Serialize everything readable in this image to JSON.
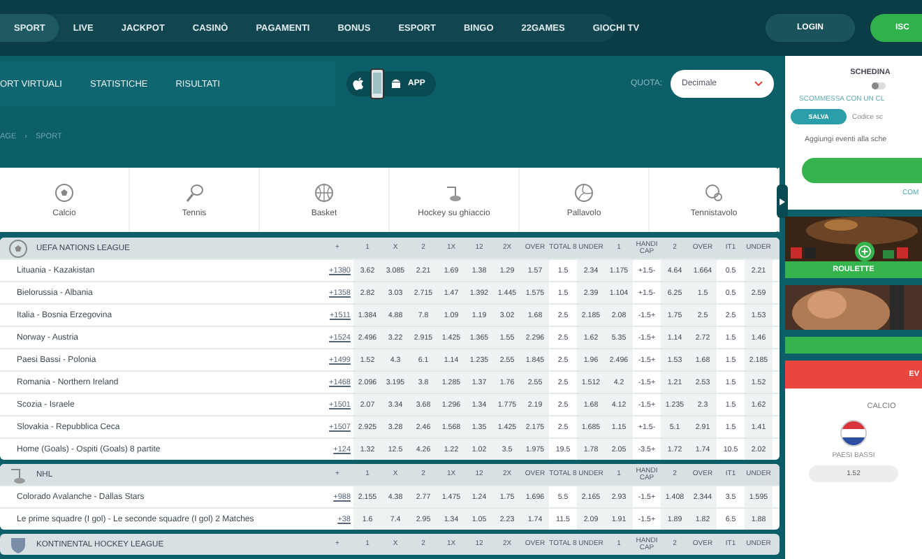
{
  "nav": {
    "items": [
      {
        "label": "SPORT",
        "selected": true
      },
      {
        "label": "LIVE",
        "selected": false
      },
      {
        "label": "JACKPOT",
        "selected": false
      },
      {
        "label": "CASINÒ",
        "selected": false
      },
      {
        "label": "PAGAMENTI",
        "selected": false
      },
      {
        "label": "BONUS",
        "selected": false
      },
      {
        "label": "ESPORT",
        "selected": false
      },
      {
        "label": "BINGO",
        "selected": false
      },
      {
        "label": "22GAMES",
        "selected": false
      },
      {
        "label": "GIOCHI TV",
        "selected": false
      }
    ],
    "login": "LOGIN",
    "register": "ISC"
  },
  "subnav": {
    "items": [
      "ORT VIRTUALI",
      "STATISTICHE",
      "RISULTATI"
    ],
    "app": "APP",
    "quota_label": "QUOTA:",
    "quota_value": "Decimale"
  },
  "breadcrumb": [
    "AGE",
    "›",
    "SPORT"
  ],
  "sports": [
    {
      "label": "Calcio",
      "kind": "soccer"
    },
    {
      "label": "Tennis",
      "kind": "tennis"
    },
    {
      "label": "Basket",
      "kind": "basketball"
    },
    {
      "label": "Hockey su ghiaccio",
      "kind": "hockey"
    },
    {
      "label": "Pallavolo",
      "kind": "volleyball"
    },
    {
      "label": "Tennistavolo",
      "kind": "pingpong"
    }
  ],
  "table": {
    "sections": [
      {
        "league": "UEFA NATIONS LEAGUE",
        "kind": "soccer",
        "columns": [
          "+",
          "1",
          "X",
          "2",
          "1X",
          "12",
          "2X",
          "OVER",
          "TOTAL 8",
          "UNDER",
          "1",
          "HANDI CAP",
          "2",
          "OVER",
          "IT1",
          "UNDER"
        ],
        "rows": [
          {
            "match": "Lituania - Kazakistan",
            "more": "+1380",
            "odds": [
              "3.62",
              "3.085",
              "2.21",
              "1.69",
              "1.38",
              "1.29",
              "1.57",
              "1.5",
              "2.34",
              "1.175",
              "+1.5-",
              "4.64",
              "1.664",
              "0.5",
              "2.21"
            ]
          },
          {
            "match": "Bielorussia - Albania",
            "more": "+1358",
            "odds": [
              "2.82",
              "3.03",
              "2.715",
              "1.47",
              "1.392",
              "1.445",
              "1.575",
              "1.5",
              "2.39",
              "1.104",
              "+1.5-",
              "6.25",
              "1.5",
              "0.5",
              "2.59"
            ]
          },
          {
            "match": "Italia - Bosnia Erzegovina",
            "more": "+1511",
            "odds": [
              "1.384",
              "4.88",
              "7.8",
              "1.09",
              "1.19",
              "3.02",
              "1.68",
              "2.5",
              "2.185",
              "2.08",
              "-1.5+",
              "1.75",
              "2.5",
              "2.5",
              "1.53"
            ]
          },
          {
            "match": "Norway - Austria",
            "more": "+1524",
            "odds": [
              "2.496",
              "3.22",
              "2.915",
              "1.425",
              "1.365",
              "1.55",
              "2.296",
              "2.5",
              "1.62",
              "5.35",
              "-1.5+",
              "1.14",
              "2.72",
              "1.5",
              "1.46"
            ]
          },
          {
            "match": "Paesi Bassi - Polonia",
            "more": "+1499",
            "odds": [
              "1.52",
              "4.3",
              "6.1",
              "1.14",
              "1.235",
              "2.55",
              "1.845",
              "2.5",
              "1.96",
              "2.496",
              "-1.5+",
              "1.53",
              "1.68",
              "1.5",
              "2.185"
            ]
          },
          {
            "match": "Romania - Northern Ireland",
            "more": "+1468",
            "odds": [
              "2.096",
              "3.195",
              "3.8",
              "1.285",
              "1.37",
              "1.76",
              "2.55",
              "2.5",
              "1.512",
              "4.2",
              "-1.5+",
              "1.21",
              "2.53",
              "1.5",
              "1.52"
            ]
          },
          {
            "match": "Scozia - Israele",
            "more": "+1501",
            "odds": [
              "2.07",
              "3.34",
              "3.68",
              "1.296",
              "1.34",
              "1.775",
              "2.19",
              "2.5",
              "1.68",
              "4.12",
              "-1.5+",
              "1.235",
              "2.3",
              "1.5",
              "1.62"
            ]
          },
          {
            "match": "Slovakia - Repubblica Ceca",
            "more": "+1507",
            "odds": [
              "2.925",
              "3.28",
              "2.46",
              "1.568",
              "1.35",
              "1.425",
              "2.175",
              "2.5",
              "1.685",
              "1.15",
              "+1.5-",
              "5.1",
              "2.91",
              "1.5",
              "1.41"
            ]
          },
          {
            "match": "Home (Goals) - Ospiti (Goals) 8 partite",
            "more": "+124",
            "odds": [
              "1.32",
              "12.5",
              "4.26",
              "1.22",
              "1.02",
              "3.5",
              "1.975",
              "19.5",
              "1.78",
              "2.05",
              "-3.5+",
              "1.72",
              "1.74",
              "10.5",
              "2.02"
            ]
          }
        ]
      },
      {
        "league": "NHL",
        "kind": "hockey",
        "columns": [
          "+",
          "1",
          "X",
          "2",
          "1X",
          "12",
          "2X",
          "OVER",
          "TOTAL 8",
          "UNDER",
          "1",
          "HANDI CAP",
          "2",
          "OVER",
          "IT1",
          "UNDER"
        ],
        "rows": [
          {
            "match": "Colorado Avalanche - Dallas Stars",
            "more": "+988",
            "odds": [
              "2.155",
              "4.38",
              "2.77",
              "1.475",
              "1.24",
              "1.75",
              "1.696",
              "5.5",
              "2.165",
              "2.93",
              "-1.5+",
              "1.408",
              "2.344",
              "3.5",
              "1.595"
            ]
          },
          {
            "match": "Le prime squadre (I gol) - Le seconde squadre (I gol) 2 Matches",
            "more": "+38",
            "odds": [
              "1.6",
              "7.4",
              "2.95",
              "1.34",
              "1.05",
              "2.23",
              "1.74",
              "11.5",
              "2.09",
              "1.91",
              "-1.5+",
              "1.89",
              "1.82",
              "6.5",
              "1.88"
            ]
          }
        ]
      },
      {
        "league": "KONTINENTAL HOCKEY LEAGUE",
        "kind": "shield",
        "columns": [
          "+",
          "1",
          "X",
          "2",
          "1X",
          "12",
          "2X",
          "OVER",
          "TOTAL 8",
          "UNDER",
          "1",
          "HANDI CAP",
          "2",
          "OVER",
          "IT1",
          "UNDER"
        ]
      }
    ]
  },
  "betslip": {
    "title": "SCHEDINA",
    "toggle_on": false,
    "toggle_label": "SCOMMESSA CON UN CL",
    "save": "SALVA",
    "code_placeholder": "Codice sc",
    "message": "Aggiungi eventi alla sche",
    "link": "COM"
  },
  "promo": {
    "label": "ROULETTE"
  },
  "event": {
    "header": "EV",
    "sport": "CALCIO",
    "team": "PAESI BASSI",
    "odds": "1.52"
  }
}
